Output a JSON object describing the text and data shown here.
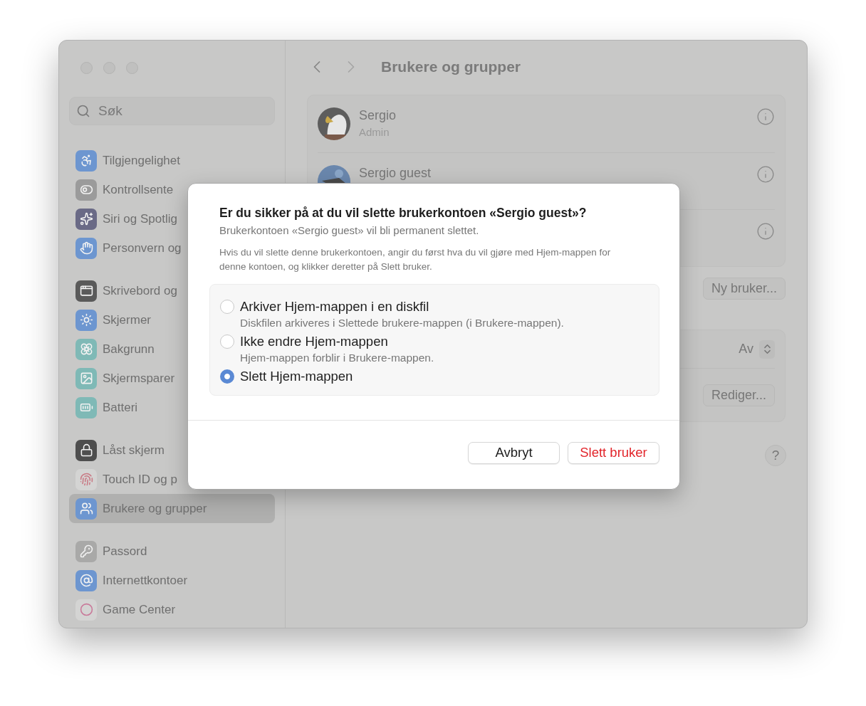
{
  "sidebar": {
    "search": {
      "placeholder": "Søk"
    },
    "groups": [
      [
        {
          "label": "Tilgjengelighet",
          "selected": false
        },
        {
          "label": "Kontrollsente",
          "selected": false
        },
        {
          "label": "Siri og Spotlig",
          "selected": false
        },
        {
          "label": "Personvern og",
          "selected": false
        }
      ],
      [
        {
          "label": "Skrivebord og",
          "selected": false
        },
        {
          "label": "Skjermer",
          "selected": false
        },
        {
          "label": "Bakgrunn",
          "selected": false
        },
        {
          "label": "Skjermsparer",
          "selected": false
        },
        {
          "label": "Batteri",
          "selected": false
        }
      ],
      [
        {
          "label": "Låst skjerm",
          "selected": false
        },
        {
          "label": "Touch ID og p",
          "selected": false
        },
        {
          "label": "Brukere og grupper",
          "selected": true
        }
      ],
      [
        {
          "label": "Passord",
          "selected": false
        },
        {
          "label": "Internettkontoer",
          "selected": false
        },
        {
          "label": "Game Center",
          "selected": false
        }
      ]
    ]
  },
  "main": {
    "title": "Brukere og grupper",
    "users": [
      {
        "kind": "user",
        "name": "Sergio",
        "role": "Admin"
      },
      {
        "kind": "user",
        "name": "Sergio guest"
      },
      {
        "kind": "covered"
      }
    ],
    "new_user_button": "Ny bruker...",
    "settings": [
      {
        "kind": "popup",
        "value": "Av"
      },
      {
        "kind": "button",
        "label": "Rediger..."
      }
    ],
    "help": "?"
  },
  "dialog": {
    "title": "Er du sikker på at du vil slette brukerkontoen «Sergio guest»?",
    "subtitle": "Brukerkontoen «Sergio guest» vil bli permanent slettet.",
    "message": "Hvis du vil slette denne brukerkontoen, angir du først hva du vil gjøre med Hjem-mappen for denne kontoen, og klikker deretter på Slett bruker.",
    "options": [
      {
        "label": "Arkiver Hjem-mappen i en diskfil",
        "description": "Diskfilen arkiveres i Slettede brukere-mappen (i Brukere-mappen).",
        "selected": false
      },
      {
        "label": "Ikke endre Hjem-mappen",
        "description": "Hjem-mappen forblir i Brukere-mappen.",
        "selected": false
      },
      {
        "label": "Slett Hjem-mappen",
        "selected": true
      }
    ],
    "buttons": [
      {
        "label": "Avbryt",
        "kind": "cancel"
      },
      {
        "label": "Slett bruker",
        "kind": "destructive"
      }
    ]
  }
}
